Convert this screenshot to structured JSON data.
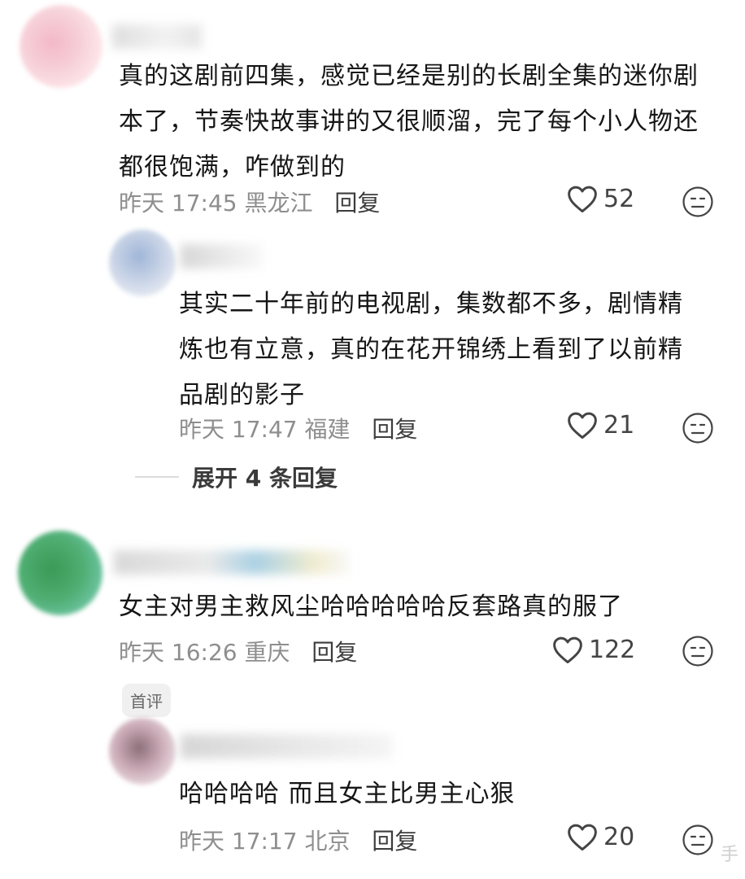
{
  "comments": [
    {
      "text_lines": [
        "真的这剧前四集，感觉已经是别的长剧全集的迷你剧",
        "本了，节奏快故事讲的又很顺溜，完了每个小人物还",
        "都很饱满，咋做到的"
      ],
      "time": "昨天 17:45",
      "location": "黑龙江",
      "reply": "回复",
      "likes": "52"
    },
    {
      "text_lines": [
        "其实二十年前的电视剧，集数都不多，剧情精",
        "炼也有立意，真的在花开锦绣上看到了以前精",
        "品剧的影子"
      ],
      "time": "昨天 17:47",
      "location": "福建",
      "reply": "回复",
      "likes": "21"
    },
    {
      "text_lines": [
        "女主对男主救风尘哈哈哈哈哈反套路真的服了"
      ],
      "time": "昨天 16:26",
      "location": "重庆",
      "reply": "回复",
      "likes": "122"
    },
    {
      "text_lines": [
        "哈哈哈哈 而且女主比男主心狠"
      ],
      "time": "昨天 17:17",
      "location": "北京",
      "reply": "回复",
      "likes": "20"
    }
  ],
  "expand_replies": "展开 4 条回复",
  "first_comment_badge": "首评",
  "watermark": "手",
  "icons": {
    "like": "heart-outline-icon",
    "dislike": "meh-face-icon"
  },
  "colors": {
    "meta": "#8e8e8e",
    "text": "#161616",
    "icon": "#444444"
  }
}
